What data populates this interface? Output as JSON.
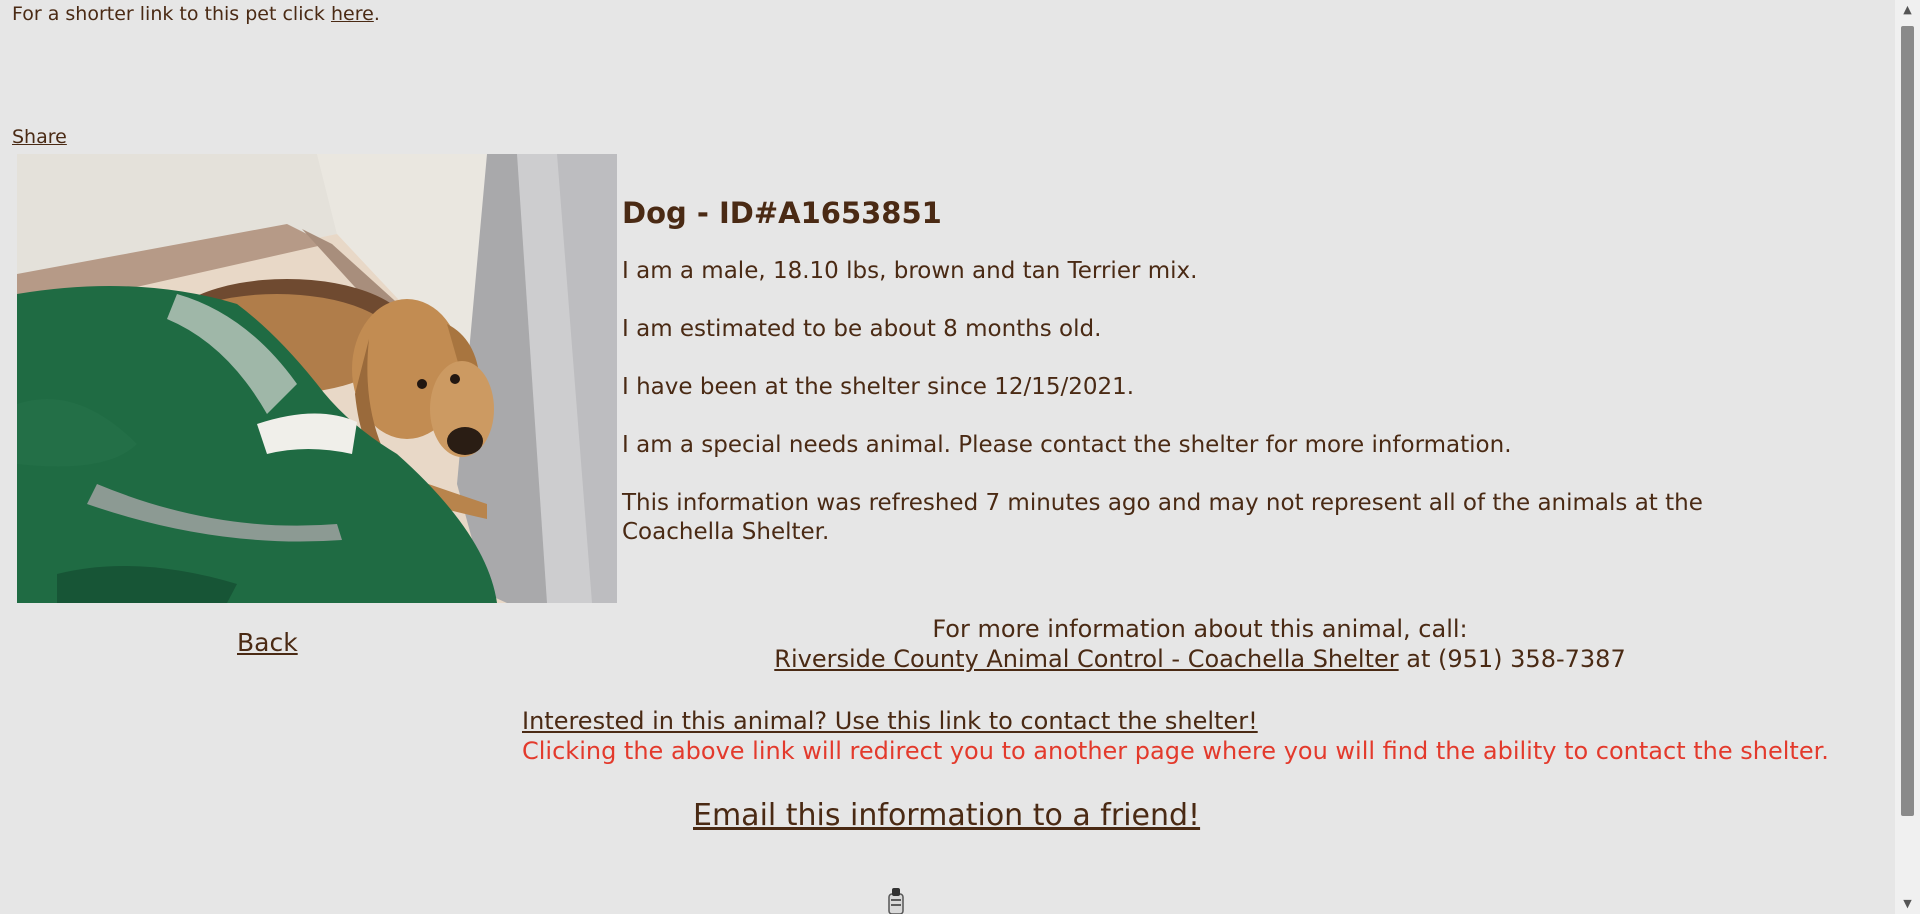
{
  "header": {
    "shortlink_prefix": "For a shorter link to this pet click ",
    "shortlink_link": "here",
    "shortlink_suffix": ".",
    "share": "Share"
  },
  "animal": {
    "title": "Dog - ID#A1653851",
    "description": "I am a male, 18.10 lbs, brown and tan Terrier mix.",
    "age": "I am estimated to be about 8 months old.",
    "since": "I have been at the shelter since 12/15/2021.",
    "special_needs": "I am a special needs animal. Please contact the shelter for more information.",
    "refresh": "This information was refreshed 7 minutes ago and may not represent all of the animals at the Coachella Shelter."
  },
  "nav": {
    "back": "Back"
  },
  "contact": {
    "call_text": "For more information about this animal, call:",
    "shelter_link": "Riverside County Animal Control - Coachella Shelter",
    "phone_text": " at (951) 358-7387",
    "interested_link": "Interested in this animal? Use this link to contact the shelter!",
    "redirect_note": "Clicking the above link will redirect you to another page where you will find the ability to contact the shelter.",
    "email_link": "Email this information to a friend!"
  },
  "colors": {
    "text": "#4a2a14",
    "background": "#e6e6e6",
    "notice": "#e33a2c"
  },
  "icons": {
    "scroll_up": "triangle-up",
    "scroll_down": "triangle-down",
    "loader": "spinner"
  }
}
